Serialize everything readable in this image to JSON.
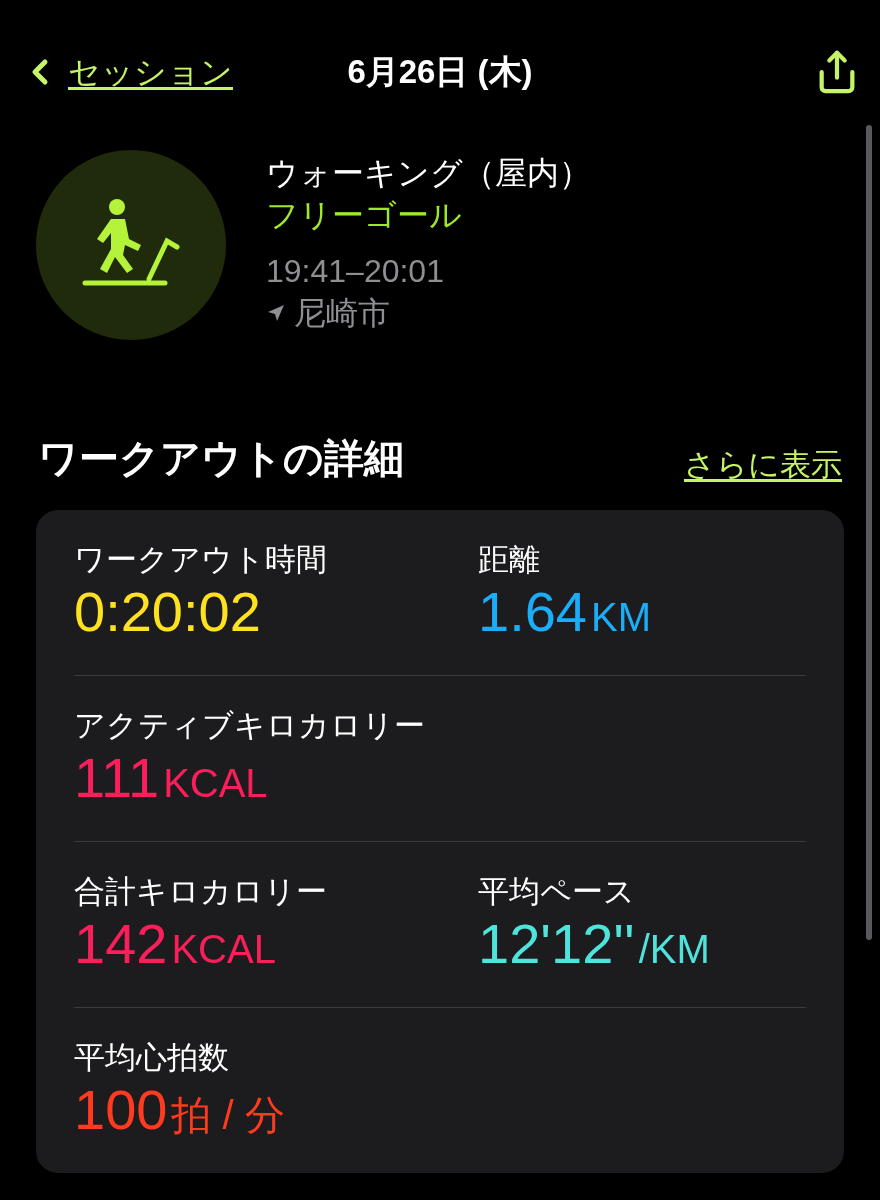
{
  "nav": {
    "back_label": "セッション",
    "title": "6月26日 (木)"
  },
  "workout": {
    "name": "ウォーキング（屋内）",
    "goal": "フリーゴール",
    "time": "19:41–20:01",
    "location": "尼崎市"
  },
  "details": {
    "title": "ワークアウトの詳細",
    "more_link": "さらに表示",
    "rows": [
      [
        {
          "label": "ワークアウト時間",
          "value": "0:20:02",
          "color": "#ffe21f"
        },
        {
          "label": "距離",
          "value": "1.64",
          "unit": "KM",
          "color": "#1badf8"
        }
      ],
      [
        {
          "label": "アクティブキロカロリー",
          "value": "111",
          "unit": "KCAL",
          "color": "#fa1e5b"
        }
      ],
      [
        {
          "label": "合計キロカロリー",
          "value": "142",
          "unit": "KCAL",
          "color": "#fa1e5b"
        },
        {
          "label": "平均ペース",
          "value": "12'12''",
          "unit": "/KM",
          "color": "#4fe3dc"
        }
      ],
      [
        {
          "label": "平均心拍数",
          "value": "100",
          "unit": "拍 / 分",
          "color": "#ff3b1f"
        }
      ]
    ]
  }
}
